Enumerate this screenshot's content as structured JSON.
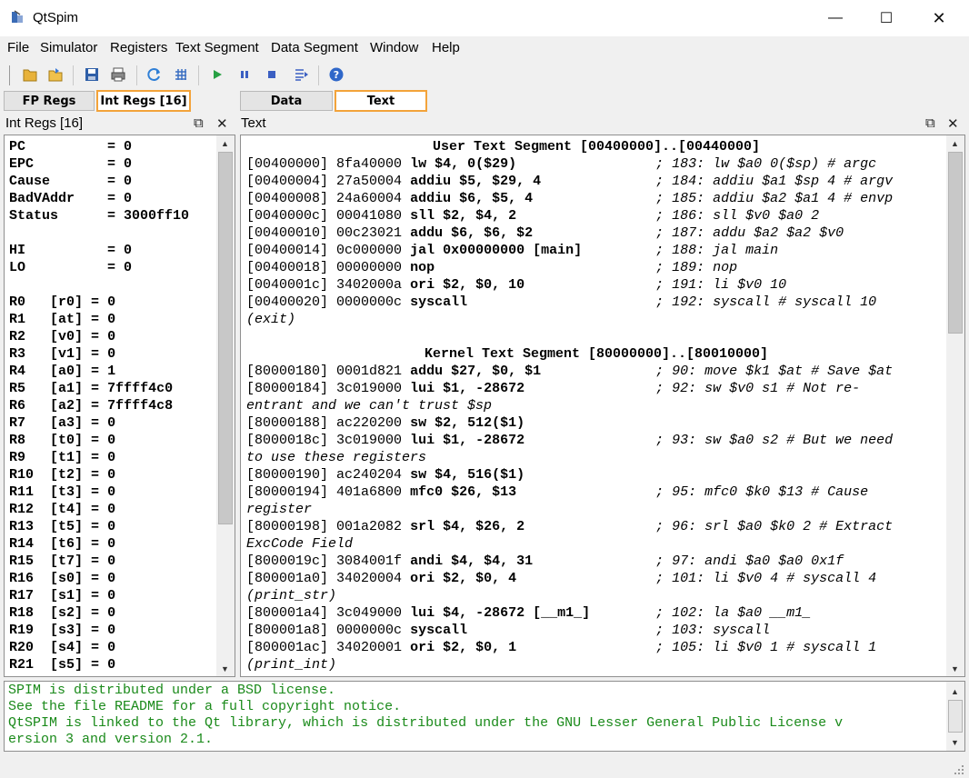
{
  "window": {
    "title": "QtSpim",
    "controls": [
      "minimize",
      "maximize",
      "close"
    ]
  },
  "menu": [
    "File",
    "Simulator",
    "Registers",
    "Text Segment",
    "Data Segment",
    "Window",
    "Help"
  ],
  "toolbar_icons": [
    "open-file-icon",
    "open-folder-icon",
    "save-icon",
    "print-icon",
    "reload-icon",
    "grid-icon",
    "run-icon",
    "pause-icon",
    "stop-icon",
    "step-icon",
    "help-icon"
  ],
  "left_tabs": [
    {
      "label": "FP Regs",
      "active": false
    },
    {
      "label": "Int Regs [16]",
      "active": true
    }
  ],
  "right_tabs": [
    {
      "label": "Data",
      "active": false
    },
    {
      "label": "Text",
      "active": true
    }
  ],
  "left_panel_title": "Int Regs [16]",
  "right_panel_title": "Text",
  "panel_float_glyph": "⧉",
  "panel_close_glyph": "✕",
  "special_regs": [
    {
      "name": "PC",
      "value": "0"
    },
    {
      "name": "EPC",
      "value": "0"
    },
    {
      "name": "Cause",
      "value": "0"
    },
    {
      "name": "BadVAddr",
      "value": "0"
    },
    {
      "name": "Status",
      "value": "3000ff10"
    }
  ],
  "hilo_regs": [
    {
      "name": "HI",
      "value": "0"
    },
    {
      "name": "LO",
      "value": "0"
    }
  ],
  "gp_regs": [
    {
      "name": "R0",
      "alias": "[r0]",
      "value": "0"
    },
    {
      "name": "R1",
      "alias": "[at]",
      "value": "0"
    },
    {
      "name": "R2",
      "alias": "[v0]",
      "value": "0"
    },
    {
      "name": "R3",
      "alias": "[v1]",
      "value": "0"
    },
    {
      "name": "R4",
      "alias": "[a0]",
      "value": "1"
    },
    {
      "name": "R5",
      "alias": "[a1]",
      "value": "7ffff4c0"
    },
    {
      "name": "R6",
      "alias": "[a2]",
      "value": "7ffff4c8"
    },
    {
      "name": "R7",
      "alias": "[a3]",
      "value": "0"
    },
    {
      "name": "R8",
      "alias": "[t0]",
      "value": "0"
    },
    {
      "name": "R9",
      "alias": "[t1]",
      "value": "0"
    },
    {
      "name": "R10",
      "alias": "[t2]",
      "value": "0"
    },
    {
      "name": "R11",
      "alias": "[t3]",
      "value": "0"
    },
    {
      "name": "R12",
      "alias": "[t4]",
      "value": "0"
    },
    {
      "name": "R13",
      "alias": "[t5]",
      "value": "0"
    },
    {
      "name": "R14",
      "alias": "[t6]",
      "value": "0"
    },
    {
      "name": "R15",
      "alias": "[t7]",
      "value": "0"
    },
    {
      "name": "R16",
      "alias": "[s0]",
      "value": "0"
    },
    {
      "name": "R17",
      "alias": "[s1]",
      "value": "0"
    },
    {
      "name": "R18",
      "alias": "[s2]",
      "value": "0"
    },
    {
      "name": "R19",
      "alias": "[s3]",
      "value": "0"
    },
    {
      "name": "R20",
      "alias": "[s4]",
      "value": "0"
    },
    {
      "name": "R21",
      "alias": "[s5]",
      "value": "0"
    }
  ],
  "text_lines": [
    {
      "type": "header",
      "text": "User Text Segment [00400000]..[00440000]"
    },
    {
      "type": "instr",
      "addr": "[00400000]",
      "code": "8fa40000",
      "asm": "lw $4, 0($29)",
      "comment": "; 183: lw $a0 0($sp) # argc"
    },
    {
      "type": "instr",
      "addr": "[00400004]",
      "code": "27a50004",
      "asm": "addiu $5, $29, 4",
      "comment": "; 184: addiu $a1 $sp 4 # argv"
    },
    {
      "type": "instr",
      "addr": "[00400008]",
      "code": "24a60004",
      "asm": "addiu $6, $5, 4",
      "comment": "; 185: addiu $a2 $a1 4 # envp"
    },
    {
      "type": "instr",
      "addr": "[0040000c]",
      "code": "00041080",
      "asm": "sll $2, $4, 2",
      "comment": "; 186: sll $v0 $a0 2"
    },
    {
      "type": "instr",
      "addr": "[00400010]",
      "code": "00c23021",
      "asm": "addu $6, $6, $2",
      "comment": "; 187: addu $a2 $a2 $v0"
    },
    {
      "type": "instr",
      "addr": "[00400014]",
      "code": "0c000000",
      "asm": "jal 0x00000000 [main]",
      "comment": "; 188: jal main"
    },
    {
      "type": "instr",
      "addr": "[00400018]",
      "code": "00000000",
      "asm": "nop",
      "comment": "; 189: nop"
    },
    {
      "type": "instr",
      "addr": "[0040001c]",
      "code": "3402000a",
      "asm": "ori $2, $0, 10",
      "comment": "; 191: li $v0 10"
    },
    {
      "type": "instr",
      "addr": "[00400020]",
      "code": "0000000c",
      "asm": "syscall",
      "comment": "; 192: syscall # syscall 10"
    },
    {
      "type": "wrap",
      "text": "(exit)"
    },
    {
      "type": "blank"
    },
    {
      "type": "header",
      "text": "Kernel Text Segment [80000000]..[80010000]"
    },
    {
      "type": "instr",
      "addr": "[80000180]",
      "code": "0001d821",
      "asm": "addu $27, $0, $1",
      "comment": "; 90: move $k1 $at # Save $at"
    },
    {
      "type": "instr",
      "addr": "[80000184]",
      "code": "3c019000",
      "asm": "lui $1, -28672",
      "comment": "; 92: sw $v0 s1 # Not re-"
    },
    {
      "type": "wrap",
      "text": "entrant and we can't trust $sp"
    },
    {
      "type": "instr",
      "addr": "[80000188]",
      "code": "ac220200",
      "asm": "sw $2, 512($1)",
      "comment": ""
    },
    {
      "type": "instr",
      "addr": "[8000018c]",
      "code": "3c019000",
      "asm": "lui $1, -28672",
      "comment": "; 93: sw $a0 s2 # But we need"
    },
    {
      "type": "wrap",
      "text": "to use these registers"
    },
    {
      "type": "instr",
      "addr": "[80000190]",
      "code": "ac240204",
      "asm": "sw $4, 516($1)",
      "comment": ""
    },
    {
      "type": "instr",
      "addr": "[80000194]",
      "code": "401a6800",
      "asm": "mfc0 $26, $13",
      "comment": "; 95: mfc0 $k0 $13 # Cause"
    },
    {
      "type": "wrap",
      "text": "register"
    },
    {
      "type": "instr",
      "addr": "[80000198]",
      "code": "001a2082",
      "asm": "srl $4, $26, 2",
      "comment": "; 96: srl $a0 $k0 2 # Extract"
    },
    {
      "type": "wrap",
      "text": "ExcCode Field"
    },
    {
      "type": "instr",
      "addr": "[8000019c]",
      "code": "3084001f",
      "asm": "andi $4, $4, 31",
      "comment": "; 97: andi $a0 $a0 0x1f"
    },
    {
      "type": "instr",
      "addr": "[800001a0]",
      "code": "34020004",
      "asm": "ori $2, $0, 4",
      "comment": "; 101: li $v0 4 # syscall 4"
    },
    {
      "type": "wrap",
      "text": "(print_str)"
    },
    {
      "type": "instr",
      "addr": "[800001a4]",
      "code": "3c049000",
      "asm": "lui $4, -28672 [__m1_]",
      "comment": "; 102: la $a0 __m1_"
    },
    {
      "type": "instr",
      "addr": "[800001a8]",
      "code": "0000000c",
      "asm": "syscall",
      "comment": "; 103: syscall"
    },
    {
      "type": "instr",
      "addr": "[800001ac]",
      "code": "34020001",
      "asm": "ori $2, $0, 1",
      "comment": "; 105: li $v0 1 # syscall 1"
    },
    {
      "type": "wrap",
      "text": "(print_int)"
    }
  ],
  "console_lines": [
    "SPIM is distributed under a BSD license.",
    "See the file README for a full copyright notice.",
    "QtSPIM is linked to the Qt library, which is distributed under the GNU Lesser General Public License v",
    "ersion 3 and version 2.1."
  ]
}
